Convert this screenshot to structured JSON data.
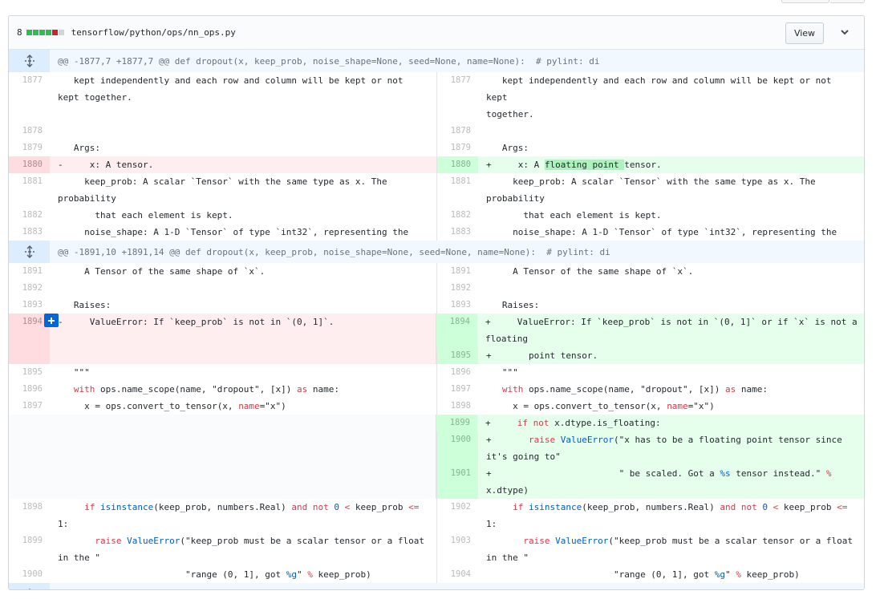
{
  "file": {
    "changes": "8",
    "path": "tensorflow/python/ops/nn_ops.py",
    "view_label": "View"
  },
  "diffstat": [
    "#2cbe4e",
    "#2cbe4e",
    "#2cbe4e",
    "#2cbe4e",
    "#cb2431",
    "#d1d5da"
  ],
  "colors": {
    "deletion": "#ffeef0",
    "addition": "#e6ffed",
    "hunk": "#f1f8ff",
    "accent": "#0366d6"
  },
  "hunks": [
    {
      "text": "@@ -1877,7 +1877,7 @@ def dropout(x, keep_prob, noise_shape=None, seed=None, name=None):  # pylint: di"
    },
    {
      "text": "@@ -1891,10 +1891,14 @@ def dropout(x, keep_prob, noise_shape=None, seed=None, name=None):  # pylint: di"
    }
  ],
  "rows": [
    {
      "l_num": "1877",
      "l_code": "   kept independently and each row and column will be kept or not\nkept together.",
      "r_num": "1877",
      "r_code": "   kept independently and each row and column will be kept or not kept\ntogether."
    },
    {
      "l_num": "1878",
      "l_code": "",
      "r_num": "1878",
      "r_code": ""
    },
    {
      "l_num": "1879",
      "l_code": "   Args:",
      "r_num": "1879",
      "r_code": "   Args:"
    },
    {
      "l_num": "1880",
      "l_code": "-     x: A tensor.",
      "r_num": "1880",
      "r_code_pre": "+     x: A ",
      "r_code_hl": "floating point ",
      "r_code_post": "tensor."
    },
    {
      "l_num": "1881",
      "l_code": "     keep_prob: A scalar `Tensor` with the same type as x. The\nprobability",
      "r_num": "1881",
      "r_code": "     keep_prob: A scalar `Tensor` with the same type as x. The\nprobability"
    },
    {
      "l_num": "1882",
      "l_code": "       that each element is kept.",
      "r_num": "1882",
      "r_code": "       that each element is kept."
    },
    {
      "l_num": "1883",
      "l_code": "     noise_shape: A 1-D `Tensor` of type `int32`, representing the",
      "r_num": "1883",
      "r_code": "     noise_shape: A 1-D `Tensor` of type `int32`, representing the"
    },
    {
      "l_num": "1891",
      "l_code": "     A Tensor of the same shape of `x`.",
      "r_num": "1891",
      "r_code": "     A Tensor of the same shape of `x`."
    },
    {
      "l_num": "1892",
      "l_code": "",
      "r_num": "1892",
      "r_code": ""
    },
    {
      "l_num": "1893",
      "l_code": "   Raises:",
      "r_num": "1893",
      "r_code": "   Raises:"
    },
    {
      "l_num": "1894",
      "l_code": "-     ValueError: If `keep_prob` is not in `(0, 1]`.",
      "r_num": "1894",
      "r_code": "+     ValueError: If `keep_prob` is not in `(0, 1]` or if `x` is not a\nfloating"
    },
    {
      "r_num": "1895",
      "r_code": "+       point tensor."
    },
    {
      "l_num": "1895",
      "l_code": "   \"\"\"",
      "r_num": "1896",
      "r_code": "   \"\"\""
    },
    {
      "l_num": "1896",
      "l_code_a": "   ",
      "l_code_kw": "with",
      "l_code_b": " ops.name_scope(name, \"dropout\", [x]) ",
      "l_code_kw2": "as",
      "l_code_c": " name:",
      "r_num": "1897"
    },
    {
      "l_num": "1897",
      "l_code_a": "     x = ops.convert_to_tensor(x, ",
      "l_code_kw": "name",
      "l_code_b": "=\"x\")",
      "r_num": "1898"
    },
    {
      "r_num": "1899",
      "r_code_a": "+     ",
      "r_code_kw": "if not",
      "r_code_b": " x.dtype.is_floating:"
    },
    {
      "r_num": "1900",
      "r_code_a": "+       ",
      "r_code_kw": "raise",
      "r_code_bi": " ValueError",
      "r_code_b": "(\"x has to be a floating point tensor since\nit's going to\""
    },
    {
      "r_num": "1901",
      "r_code_a": "+                        \" be scaled. Got a ",
      "r_code_bi": "%s",
      "r_code_b": " tensor instead.\" ",
      "r_code_kw": "%",
      "r_code_c": "\nx.dtype)"
    },
    {
      "l_num": "1898",
      "r_num": "1902",
      "code_a": "     ",
      "code_kw": "if",
      "code_bi": " isinstance",
      "code_b": "(keep_prob, numbers.Real) ",
      "code_kw2": "and not",
      "code_c": " ",
      "code_bi2": "0",
      "code_d": " ",
      "code_kw3": "<",
      "code_e": " keep_prob ",
      "code_kw4": "<=",
      "code_f": "\n1:"
    },
    {
      "l_num": "1899",
      "r_num": "1903",
      "code_a": "       ",
      "code_kw": "raise",
      "code_bi": " ValueError",
      "code_b": "(\"keep_prob must be a scalar tensor or a float\nin the \""
    },
    {
      "l_num": "1900",
      "r_num": "1904",
      "code_a": "                        \"range (0, 1], got ",
      "code_bi": "%g",
      "code_b": "\" ",
      "code_kw": "%",
      "code_c": " keep_prob)"
    }
  ]
}
